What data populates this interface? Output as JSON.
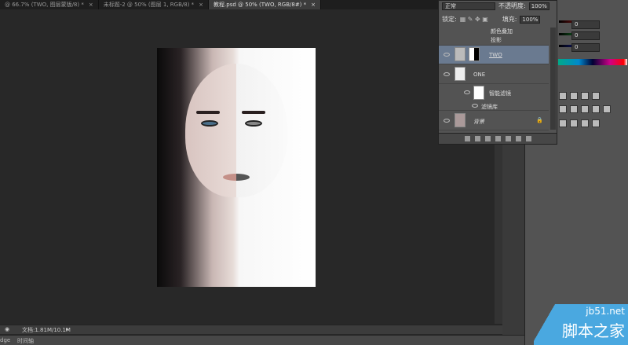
{
  "tabs": [
    {
      "label": "@ 66.7% (TWO, 图层蒙版/8) *"
    },
    {
      "label": "未标题-2 @ 50% (图层 1, RGB/8) *"
    },
    {
      "label": "教程.psd @ 50% (TWO, RGB/8#) *",
      "active": true
    }
  ],
  "layers_panel": {
    "blend_mode": "正常",
    "opacity_label": "不透明度:",
    "opacity": "100%",
    "lock_label": "锁定:",
    "fill_label": "填充:",
    "fill": "100%",
    "layers": [
      {
        "name": "颜色叠加"
      },
      {
        "name": "投影"
      },
      {
        "name": "TWO",
        "selected": true
      },
      {
        "name": "ONE"
      },
      {
        "name": "智能滤镜"
      },
      {
        "name": "滤镜库"
      },
      {
        "name": "背景"
      }
    ]
  },
  "color_panel": {
    "r": "0",
    "g": "0",
    "b": "0",
    "colors": {
      "r": "#e02020",
      "g": "#20c040",
      "b": "#2030e0"
    }
  },
  "status": {
    "doc": "文档:1.81M/10.1M"
  },
  "bottom_tabs": [
    "dge",
    "时间轴"
  ],
  "watermark": {
    "site": "jb51.net",
    "name": "脚本之家"
  }
}
